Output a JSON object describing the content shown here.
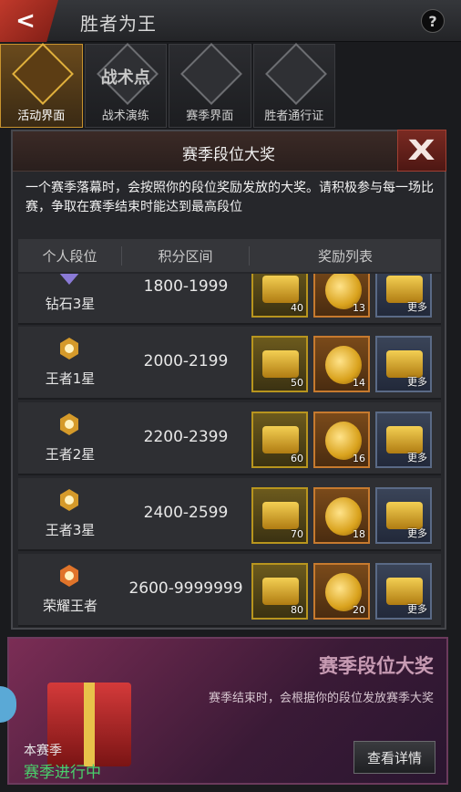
{
  "header": {
    "title": "胜者为王",
    "help_label": "?"
  },
  "tabs": [
    {
      "label": "活动界面",
      "emblem": "",
      "active": true
    },
    {
      "label": "战术演练",
      "emblem": "战术点",
      "active": false
    },
    {
      "label": "赛季界面",
      "emblem": "",
      "active": false
    },
    {
      "label": "胜者通行证",
      "emblem": "",
      "active": false
    }
  ],
  "modal": {
    "title": "赛季段位大奖",
    "description": "一个赛季落幕时，会按照你的段位奖励发放的大奖。请积极参与每一场比赛，争取在赛季结束时能达到最高段位",
    "columns": [
      "个人段位",
      "积分区间",
      "奖励列表"
    ],
    "more_label": "更多",
    "rows": [
      {
        "rank": "钻石3星",
        "score": "1800-1999",
        "chest": "40",
        "coin": "13"
      },
      {
        "rank": "王者1星",
        "score": "2000-2199",
        "chest": "50",
        "coin": "14"
      },
      {
        "rank": "王者2星",
        "score": "2200-2399",
        "chest": "60",
        "coin": "16"
      },
      {
        "rank": "王者3星",
        "score": "2400-2599",
        "chest": "70",
        "coin": "18"
      },
      {
        "rank": "荣耀王者",
        "score": "2600-9999999",
        "chest": "80",
        "coin": "20"
      }
    ]
  },
  "banner": {
    "title": "赛季段位大奖",
    "description": "赛季结束时，会根据你的段位发放赛季大奖",
    "season_label": "本赛季",
    "season_status": "赛季进行中",
    "detail_button": "查看详情"
  },
  "colors": {
    "accent_gold": "#c8932e",
    "status_green": "#49d06b",
    "close_red": "#7a2a22"
  }
}
